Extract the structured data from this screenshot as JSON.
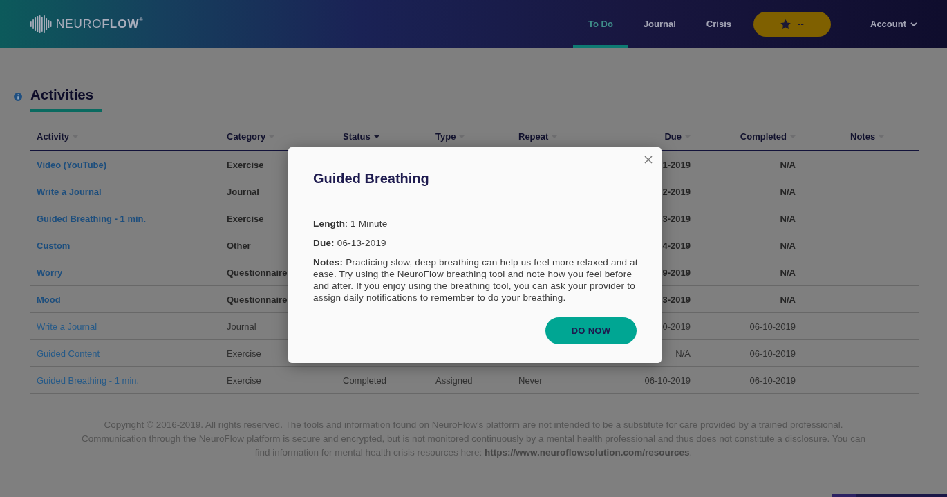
{
  "header": {
    "logo": "NEURO**FLOW**$^{®}$",
    "tabs": [
      {
        "label": "To Do",
        "selected": true
      },
      {
        "label": "Journal",
        "selected": false
      },
      {
        "label": "Crisis",
        "selected": false
      }
    ],
    "points": "--",
    "account": "Account"
  },
  "activities": {
    "title": "Activities",
    "table": {
      "columns": [
        {
          "label": "Activity",
          "sorted": false
        },
        {
          "label": "Category",
          "sorted": false
        },
        {
          "label": "Status",
          "sorted": true
        },
        {
          "label": "Type",
          "sorted": false
        },
        {
          "label": "Repeat",
          "sorted": false
        },
        {
          "label": "Due",
          "sorted": false
        },
        {
          "label": "Completed",
          "sorted": false
        },
        {
          "label": "Notes",
          "sorted": false
        }
      ],
      "rows": [
        {
          "activity": "Video (YouTube)",
          "category": "Exercise",
          "due": "1-2019",
          "completed": "N/A",
          "emphasized": true
        },
        {
          "activity": "Write a Journal",
          "category": "Journal",
          "due": "2-2019",
          "completed": "N/A",
          "emphasized": true
        },
        {
          "activity": "Guided Breathing - 1 min.",
          "category": "Exercise",
          "due": "3-2019",
          "completed": "N/A",
          "emphasized": true
        },
        {
          "activity": "Custom",
          "category": "Other",
          "due": "4-2019",
          "completed": "N/A",
          "emphasized": true
        },
        {
          "activity": "Worry",
          "category": "Questionnaire",
          "due": "9-2019",
          "completed": "N/A",
          "emphasized": true
        },
        {
          "activity": "Mood",
          "category": "Questionnaire",
          "due": "3-2019",
          "completed": "N/A",
          "emphasized": true
        },
        {
          "activity": "Write a Journal",
          "category": "Journal",
          "due": "0-2019",
          "completed": "06-10-2019",
          "emphasized": false
        },
        {
          "activity": "Guided Content",
          "category": "Exercise",
          "due": "N/A",
          "completed": "06-10-2019",
          "emphasized": false
        },
        {
          "activity": "Guided Breathing - 1 min.",
          "category": "Exercise",
          "status": "Completed",
          "type": "Assigned",
          "repeat": "Never",
          "due": "06-10-2019",
          "completed": "06-10-2019",
          "emphasized": false
        }
      ]
    }
  },
  "modal": {
    "title": "Guided Breathing",
    "details": [
      "**Length**: 1 Minute",
      "**Due:** 06-13-2019",
      "**Notes:** Practicing slow, deep breathing can help us feel more relaxed and at ease. Try using the NeuroFlow breathing tool and note how you feel before and after. If you enjoy using the breathing tool, you can ask your provider to assign daily notifications to remember to do your breathing."
    ],
    "button": "DO NOW"
  },
  "footer": {
    "text": "Copyright © 2016-2019. All rights reserved. The tools and information found on NeuroFlow's platform are not intended to be a substitute for care provided by a trained professional. Communication through the NeuroFlow platform is secure and encrypted, but is not monitored continuously by a mental health professional and thus does not constitute a disclosure. You can find information for mental health crisis resources here:",
    "link": "https://www.neuroflowsolution.com/resources",
    "suffix": "."
  }
}
